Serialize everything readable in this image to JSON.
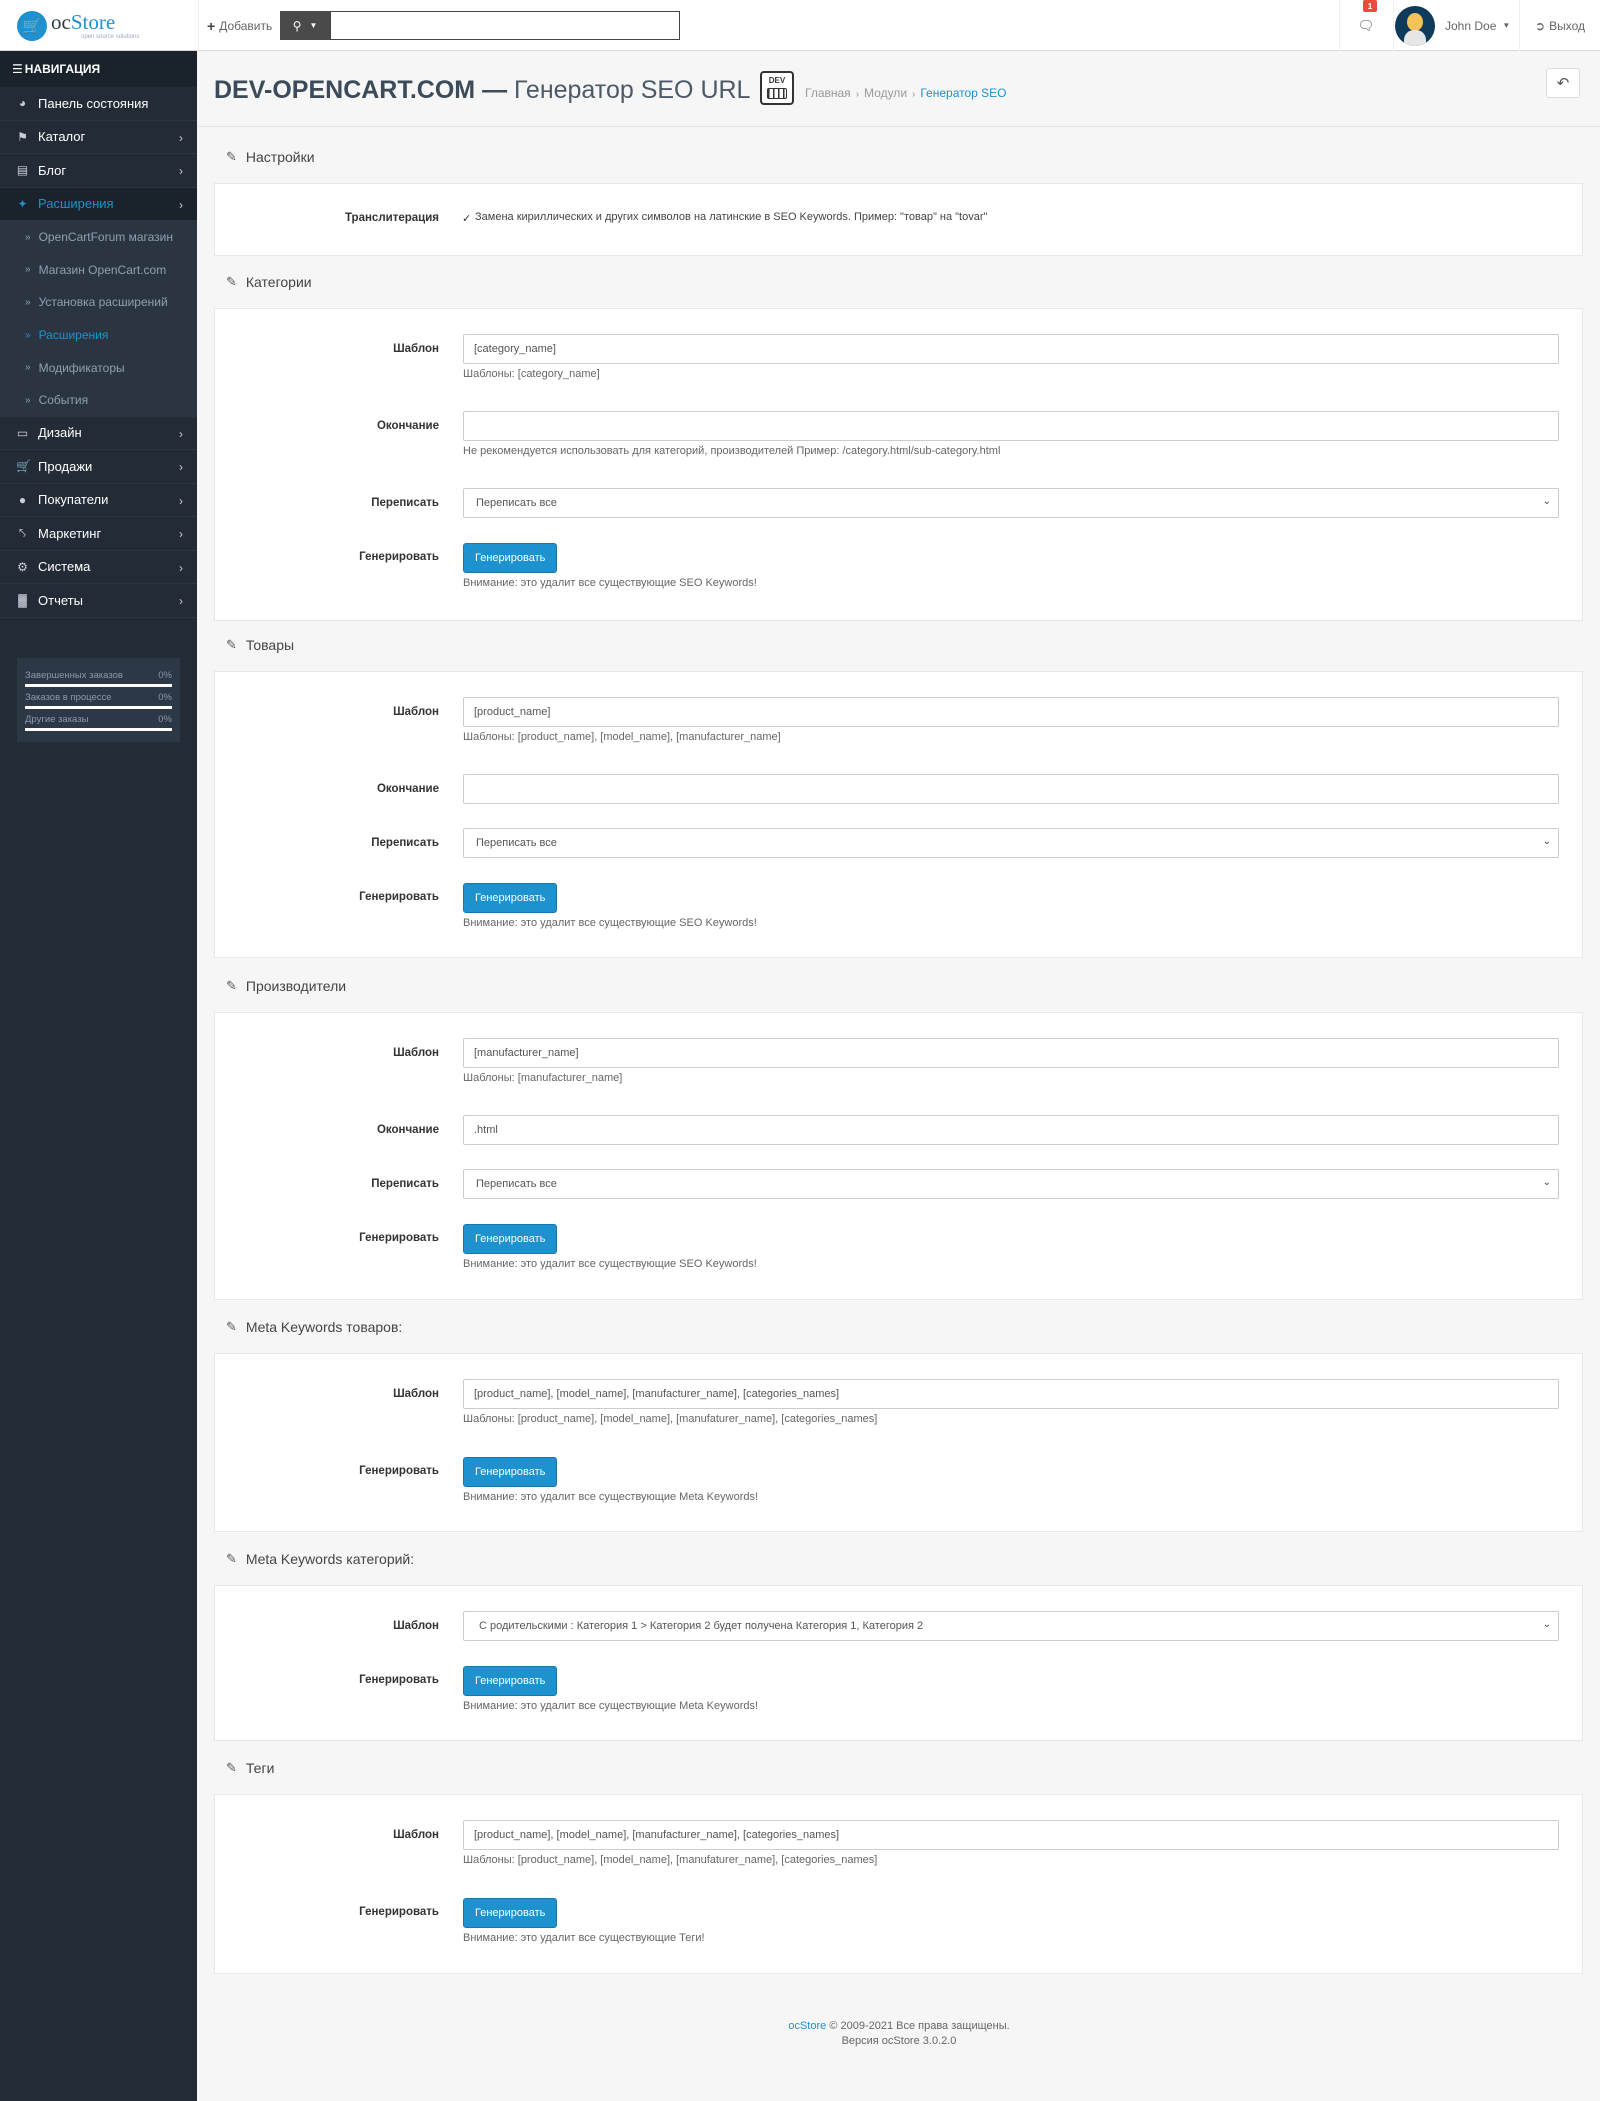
{
  "header": {
    "logo_oc": "oc",
    "logo_store": "Store",
    "logo_sub": "open source solutions",
    "add_label": "Добавить",
    "search_placeholder": "",
    "notif_count": "1",
    "user_name": "John Doe",
    "logout_label": "Выход"
  },
  "sidebar": {
    "title": "НАВИГАЦИЯ",
    "items": [
      {
        "label": "Панель состояния",
        "icon": "dashboard-icon",
        "chevron": false
      },
      {
        "label": "Каталог",
        "icon": "tags-icon",
        "chevron": true
      },
      {
        "label": "Блог",
        "icon": "book-icon",
        "chevron": true
      },
      {
        "label": "Расширения",
        "icon": "puzzle-icon",
        "chevron": true,
        "active": true
      }
    ],
    "sub_items": [
      {
        "label": "OpenCartForum магазин"
      },
      {
        "label": "Магазин OpenCart.com"
      },
      {
        "label": "Установка расширений"
      },
      {
        "label": "Расширения",
        "active": true
      },
      {
        "label": "Модификаторы"
      },
      {
        "label": "События"
      }
    ],
    "items_after": [
      {
        "label": "Дизайн",
        "icon": "desktop-icon"
      },
      {
        "label": "Продажи",
        "icon": "cart-icon"
      },
      {
        "label": "Покупатели",
        "icon": "user-icon"
      },
      {
        "label": "Маркетинг",
        "icon": "share-icon"
      },
      {
        "label": "Система",
        "icon": "cog-icon"
      },
      {
        "label": "Отчеты",
        "icon": "bar-chart-icon"
      }
    ],
    "stats": [
      {
        "label": "Завершенных заказов",
        "value": "0%"
      },
      {
        "label": "Заказов в процессе",
        "value": "0%"
      },
      {
        "label": "Другие заказы",
        "value": "0%"
      }
    ]
  },
  "page": {
    "title_bold": "DEV-OPENCART.COM —",
    "title_light": "Генератор SEO URL",
    "dev_icon_text": "DEV",
    "breadcrumb": [
      "Главная",
      "Модули",
      "Генератор SEO"
    ]
  },
  "labels": {
    "template": "Шаблон",
    "ending": "Окончание",
    "rewrite": "Переписать",
    "generate": "Генерировать",
    "generate_btn": "Генерировать",
    "rewrite_value": "Переписать все"
  },
  "settings": {
    "title": "Настройки",
    "translit_label": "Транслитерация",
    "translit_text": "Замена кириллических и других символов на латинские в SEO Keywords. Пример: \"товар\" на \"tovar\""
  },
  "categories": {
    "title": "Категории",
    "template_value": "[category_name]",
    "template_help": "Шаблоны: [category_name]",
    "ending_value": "",
    "ending_help": "Не рекомендуется использовать для категорий, производителей Пример: /category.html/sub-category.html",
    "warning": "Внимание: это удалит все существующие SEO Keywords!"
  },
  "products": {
    "title": "Товары",
    "template_value": "[product_name]",
    "template_help": "Шаблоны: [product_name], [model_name], [manufacturer_name]",
    "ending_value": "",
    "warning": "Внимание: это удалит все существующие SEO Keywords!"
  },
  "manufacturers": {
    "title": "Производители",
    "template_value": "[manufacturer_name]",
    "template_help": "Шаблоны: [manufacturer_name]",
    "ending_value": ".html",
    "warning": "Внимание: это удалит все существующие SEO Keywords!"
  },
  "meta_products": {
    "title": "Meta Keywords товаров:",
    "template_value": "[product_name], [model_name], [manufacturer_name], [categories_names]",
    "template_help": "Шаблоны: [product_name], [model_name], [manufaturer_name], [categories_names]",
    "warning": "Внимание: это удалит все существующие Meta Keywords!"
  },
  "meta_categories": {
    "title": "Meta Keywords категорий:",
    "template_value": "С родительскими : Категория 1 > Категория 2 будет получена Категория 1, Категория 2",
    "warning": "Внимание: это удалит все существующие Meta Keywords!"
  },
  "tags": {
    "title": "Теги",
    "template_value": "[product_name], [model_name], [manufacturer_name], [categories_names]",
    "template_help": "Шаблоны: [product_name], [model_name], [manufaturer_name], [categories_names]",
    "warning": "Внимание: это удалит все существующие Теги!"
  },
  "footer": {
    "brand": "ocStore",
    "copyright": "© 2009-2021 Все права защищены.",
    "version": "Версия ocStore 3.0.2.0"
  }
}
